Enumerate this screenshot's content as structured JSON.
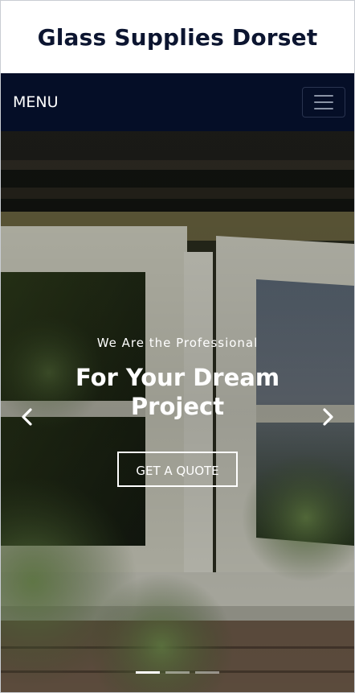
{
  "header": {
    "title": "Glass Supplies Dorset"
  },
  "navbar": {
    "menu_label": "MENU",
    "toggle_icon": "hamburger-icon"
  },
  "hero": {
    "kicker": "We Are the Professional",
    "headline": "For Your Dream Project",
    "cta_label": "GET A QUOTE",
    "prev_icon": "chevron-left-icon",
    "next_icon": "chevron-right-icon",
    "slide_count": 3,
    "active_slide": 1
  },
  "colors": {
    "nav_bg": "#050e27",
    "title": "#0c1530",
    "text_on_hero": "#ffffff"
  }
}
